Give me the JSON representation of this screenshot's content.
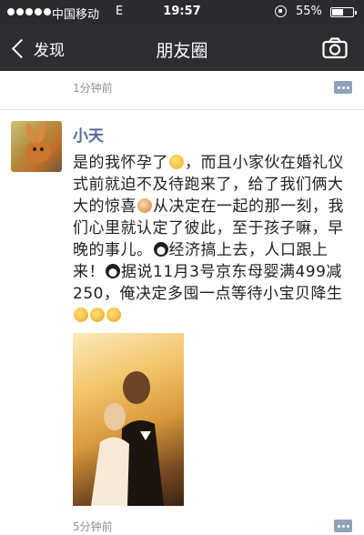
{
  "status_bar": {
    "carrier": "中国移动",
    "network": "E",
    "time": "19:57",
    "battery_percent": "55%",
    "battery_level": 0.55
  },
  "nav": {
    "back_label": "发现",
    "title": "朋友圈"
  },
  "previous_post": {
    "timestamp": "1分钟前"
  },
  "post": {
    "author": "小天",
    "text_parts": {
      "p1": "是的我怀孕了",
      "p2": "，而且小家伙在婚礼仪式前就迫不及待跑来了，给了我们俩大大的惊喜",
      "p3": "从决定在一起的那一刻，我们心里就认定了彼此，至于孩子嘛，早晚的事儿。",
      "p4": "经济搞上去，人口跟上来！",
      "p5": "据说11月3号京东母婴满499减250，俺决定多囤一点等待小宝贝降生"
    },
    "timestamp": "5分钟前"
  },
  "colors": {
    "nav_background": "#2e2e30",
    "username": "#576b95",
    "timestamp": "#8f8f94"
  },
  "icons": [
    "back-chevron-icon",
    "camera-icon",
    "comment-icon",
    "rotation-lock-icon",
    "battery-icon",
    "signal-icon"
  ]
}
